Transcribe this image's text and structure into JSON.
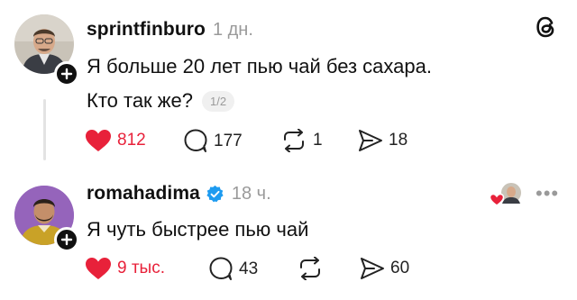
{
  "posts": [
    {
      "username": "sprintfinburo",
      "time": "1 дн.",
      "text_lines": [
        "Я больше 20 лет пью чай без сахара.",
        "Кто так же?"
      ],
      "page_indicator": "1/2",
      "actions": {
        "likes": "812",
        "comments": "177",
        "reposts": "1",
        "shares": "18"
      }
    },
    {
      "username": "romahadima",
      "verified": true,
      "time": "18 ч.",
      "text": "Я чуть быстрее пью чай",
      "actions": {
        "likes": "9 тыс.",
        "comments": "43",
        "shares": "60"
      }
    }
  ],
  "colors": {
    "like_red": "#e8213a",
    "verified_blue": "#1d9bf0",
    "muted_gray": "#9a9a9a"
  },
  "icons": [
    "threads-logo-icon",
    "heart-icon",
    "comment-icon",
    "repost-icon",
    "share-icon",
    "verified-badge-icon",
    "more-options-icon"
  ]
}
